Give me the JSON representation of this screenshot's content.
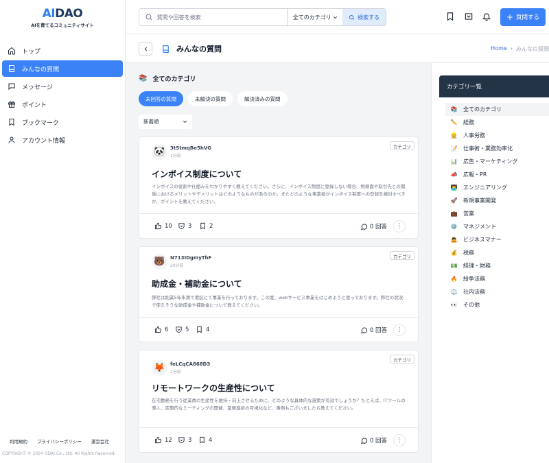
{
  "logo": {
    "ai": "AI",
    "dao": "DAO",
    "tagline": "AIを育てるコミュニティサイト"
  },
  "sidebar": {
    "items": [
      {
        "label": "トップ"
      },
      {
        "label": "みんなの質問"
      },
      {
        "label": "メッセージ"
      },
      {
        "label": "ポイント"
      },
      {
        "label": "ブックマーク"
      },
      {
        "label": "アカウント情報"
      }
    ],
    "footer_links": [
      "利用規約",
      "プライバシーポリシー",
      "運営会社"
    ],
    "copyright": "COPYRIGHT © 2024 ODAI Co., Ltd. All Rights Reserved."
  },
  "header": {
    "search_placeholder": "質問や回答を検索",
    "category_select": "全てのカテゴリ",
    "search_button": "検索する",
    "ask_button": "質問する"
  },
  "titlebar": {
    "title": "みんなの質問",
    "breadcrumb_home": "Home",
    "breadcrumb_current": "みんなの質問"
  },
  "main": {
    "section_emoji": "📚",
    "section_title": "全てのカテゴリ",
    "tabs": [
      "未回答の質問",
      "未解決の質問",
      "解決済みの質問"
    ],
    "sort": "新着順"
  },
  "questions": [
    {
      "avatar": "🐼",
      "user": "3tStmqBe5hVG",
      "time": "1分前",
      "category": "カテゴリ",
      "title": "インボイス制度について",
      "body": "インボイスの役割や仕組みをわかりやすく教えてください。さらに、インボイス制度に登録しない場合、税務面や取引先との関係におけるメリットやデメリットはどのようなものがあるのか。またどのような事業者がインボイス制度への登録を検討すべきか、ポイントを教えてください。",
      "likes": "10",
      "hearts": "3",
      "bookmarks": "2",
      "answers": "0 回答"
    },
    {
      "avatar": "🐻",
      "user": "N713IDgmyThF",
      "time": "20分前",
      "category": "カテゴリ",
      "title": "助成金・補助金について",
      "body": "弊社は創業5年朱満で港区にて事業を行っております。この度、webサービス事業をはじめようと思っております。弊社の状況で使えそうな助成金や補助金について教えてください。",
      "likes": "6",
      "hearts": "5",
      "bookmarks": "4",
      "answers": "0 回答"
    },
    {
      "avatar": "🦊",
      "user": "feLCqCA868D3",
      "time": "2分前",
      "category": "カテゴリ",
      "title": "リモートワークの生産性について",
      "body": "在宅勤務を行う従業員の生産性を維持・向上させるために、どのような具体的な施策が有効でしょうか？たとえば、ITツールの導入、定期的なミーティングの開催、業務進捗の可視化など、事例もございましたら教えてください。",
      "likes": "12",
      "hearts": "3",
      "bookmarks": "4",
      "answers": "0 回答"
    }
  ],
  "categories": {
    "header": "カテゴリ一覧",
    "items": [
      {
        "emoji": "📚",
        "label": "全てのカテゴリ"
      },
      {
        "emoji": "✏️",
        "label": "総務"
      },
      {
        "emoji": "👷",
        "label": "人事労務"
      },
      {
        "emoji": "📝",
        "label": "仕事術・業務効率化"
      },
      {
        "emoji": "📊",
        "label": "広告・マーケティング"
      },
      {
        "emoji": "📣",
        "label": "広報・PR"
      },
      {
        "emoji": "👨‍💻",
        "label": "エンジニアリング"
      },
      {
        "emoji": "🚀",
        "label": "新規事業開発"
      },
      {
        "emoji": "💼",
        "label": "営業"
      },
      {
        "emoji": "⚙️",
        "label": "マネジメント"
      },
      {
        "emoji": "🙇",
        "label": "ビジネスマナー"
      },
      {
        "emoji": "💰",
        "label": "税務"
      },
      {
        "emoji": "💵",
        "label": "経理・財務"
      },
      {
        "emoji": "🔥",
        "label": "紛争法務"
      },
      {
        "emoji": "⚖️",
        "label": "社内法務"
      },
      {
        "emoji": "👀",
        "label": "その他"
      }
    ]
  },
  "colors": {
    "primary": "#3b82f6",
    "panel_header": "#243447",
    "logo_navy": "#1e3a5f"
  }
}
